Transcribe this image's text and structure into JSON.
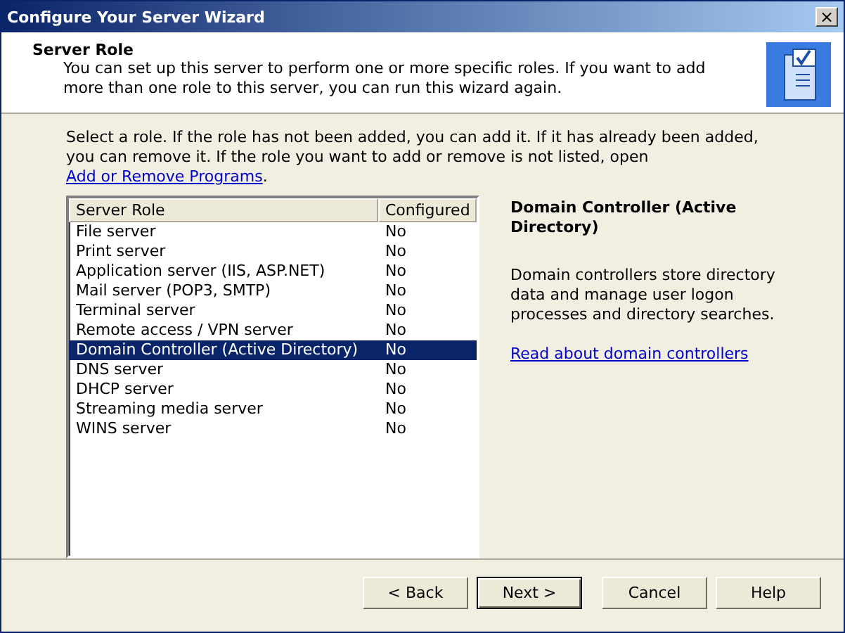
{
  "window": {
    "title": "Configure Your Server Wizard",
    "close_label": "×"
  },
  "header": {
    "title": "Server Role",
    "description": "You can set up this server to perform one or more specific roles. If you want to add more than one role to this server, you can run this wizard again."
  },
  "intro": {
    "text": "Select a role. If the role has not been added, you can add it. If it has already been added, you can remove it. If the role you want to add or remove is not listed, open ",
    "link": "Add or Remove Programs",
    "end": "."
  },
  "table": {
    "columns": [
      "Server Role",
      "Configured"
    ],
    "rows": [
      {
        "role": "File server",
        "configured": "No",
        "selected": false
      },
      {
        "role": "Print server",
        "configured": "No",
        "selected": false
      },
      {
        "role": "Application server (IIS, ASP.NET)",
        "configured": "No",
        "selected": false
      },
      {
        "role": "Mail server (POP3, SMTP)",
        "configured": "No",
        "selected": false
      },
      {
        "role": "Terminal server",
        "configured": "No",
        "selected": false
      },
      {
        "role": "Remote access / VPN server",
        "configured": "No",
        "selected": false
      },
      {
        "role": "Domain Controller (Active Directory)",
        "configured": "No",
        "selected": true
      },
      {
        "role": "DNS server",
        "configured": "No",
        "selected": false
      },
      {
        "role": "DHCP server",
        "configured": "No",
        "selected": false
      },
      {
        "role": "Streaming media server",
        "configured": "No",
        "selected": false
      },
      {
        "role": "WINS server",
        "configured": "No",
        "selected": false
      }
    ]
  },
  "details": {
    "title": "Domain Controller (Active Directory)",
    "description": "Domain controllers store directory data and manage user logon processes and directory searches.",
    "link": "Read about domain controllers"
  },
  "buttons": [
    {
      "label": "< Back",
      "default": false
    },
    {
      "label": "Next >",
      "default": true
    },
    {
      "label": "Cancel",
      "default": false
    },
    {
      "label": "Help",
      "default": false
    }
  ]
}
